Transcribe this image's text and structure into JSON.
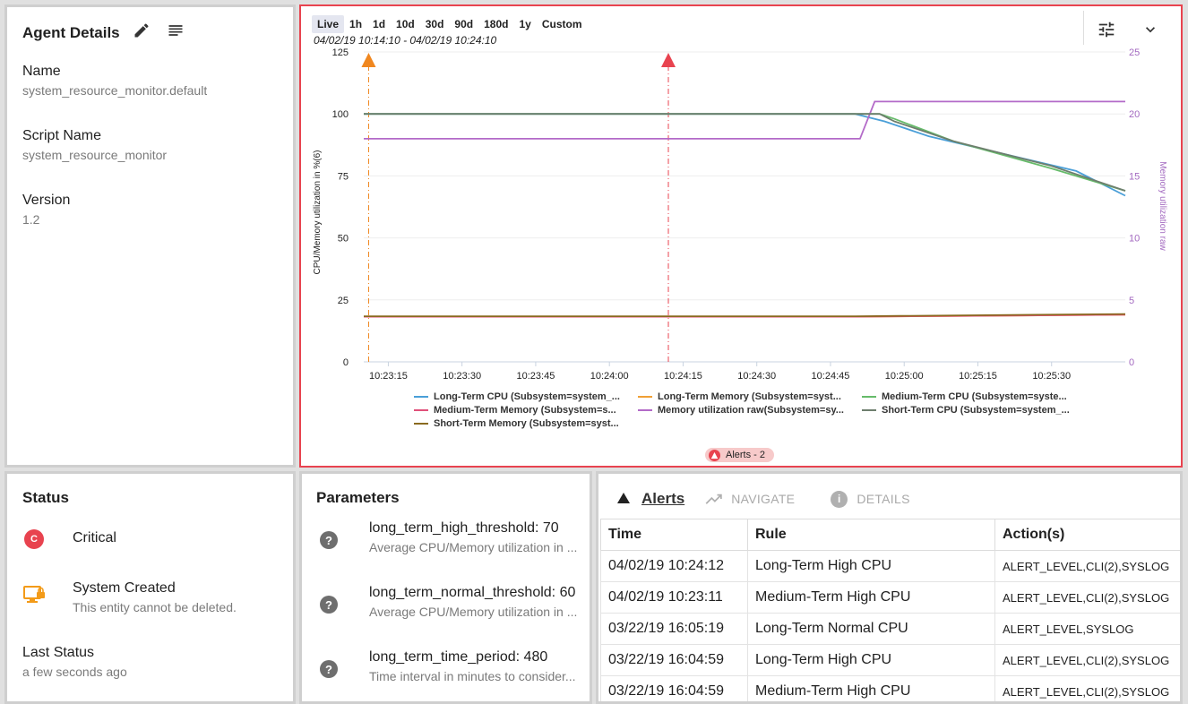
{
  "agent": {
    "title": "Agent Details",
    "fields": [
      {
        "label": "Name",
        "value": "system_resource_monitor.default"
      },
      {
        "label": "Script Name",
        "value": "system_resource_monitor"
      },
      {
        "label": "Version",
        "value": "1.2"
      }
    ]
  },
  "chart_panel": {
    "ranges": [
      "Live",
      "1h",
      "1d",
      "10d",
      "30d",
      "90d",
      "180d",
      "1y",
      "Custom"
    ],
    "active_range": "Live",
    "date_range": "04/02/19 10:14:10 - 04/02/19 10:24:10",
    "alerts_badge": "Alerts - 2"
  },
  "chart_data": {
    "type": "line",
    "ylabel": "CPU/Memory utilization in %(6)",
    "y2label": "Memory utilization raw",
    "ylim": [
      0,
      125
    ],
    "y2lim": [
      0,
      25
    ],
    "yticks": [
      0,
      25,
      50,
      75,
      100,
      125
    ],
    "y2ticks": [
      0,
      5,
      10,
      15,
      20,
      25
    ],
    "xticks": [
      "10:23:15",
      "10:23:30",
      "10:23:45",
      "10:24:00",
      "10:24:15",
      "10:24:30",
      "10:24:45",
      "10:25:00",
      "10:25:15",
      "10:25:30"
    ],
    "x_range_seconds": [
      0,
      155
    ],
    "markers": [
      {
        "x": "10:23:11",
        "color": "#f0871f"
      },
      {
        "x": "10:24:12",
        "color": "#e8434f"
      }
    ],
    "series": [
      {
        "name": "Long-Term CPU (Subsystem=system_...",
        "color": "#4a9fd8",
        "axis": "left",
        "points": [
          [
            0,
            100
          ],
          [
            100,
            100
          ],
          [
            106,
            97
          ],
          [
            115,
            91
          ],
          [
            130,
            84
          ],
          [
            145,
            77
          ],
          [
            155,
            67
          ]
        ]
      },
      {
        "name": "Long-Term Memory (Subsystem=syst...",
        "color": "#f0a035",
        "axis": "left",
        "points": [
          [
            0,
            18.2
          ],
          [
            100,
            18.2
          ],
          [
            155,
            19
          ]
        ]
      },
      {
        "name": "Medium-Term CPU (Subsystem=syste...",
        "color": "#66bb6a",
        "axis": "left",
        "points": [
          [
            0,
            100
          ],
          [
            100,
            100
          ],
          [
            105,
            100
          ],
          [
            108,
            98
          ],
          [
            120,
            89
          ],
          [
            140,
            78
          ],
          [
            155,
            69
          ]
        ]
      },
      {
        "name": "Medium-Term Memory (Subsystem=s...",
        "color": "#e0517a",
        "axis": "left",
        "points": [
          [
            0,
            18.2
          ],
          [
            100,
            18.2
          ],
          [
            155,
            19
          ]
        ]
      },
      {
        "name": "Memory utilization raw(Subsystem=sy...",
        "color": "#b36ac8",
        "axis": "right",
        "points": [
          [
            0,
            18
          ],
          [
            101,
            18
          ],
          [
            104,
            21
          ],
          [
            155,
            21
          ]
        ]
      },
      {
        "name": "Short-Term CPU (Subsystem=system_...",
        "color": "#6e7f6e",
        "axis": "left",
        "points": [
          [
            0,
            100
          ],
          [
            102,
            100
          ],
          [
            105,
            100
          ],
          [
            108,
            97
          ],
          [
            120,
            89
          ],
          [
            140,
            79
          ],
          [
            155,
            69
          ]
        ]
      },
      {
        "name": "Short-Term Memory (Subsystem=syst...",
        "color": "#8a6a1f",
        "axis": "left",
        "points": [
          [
            0,
            18.4
          ],
          [
            100,
            18.4
          ],
          [
            155,
            19.3
          ]
        ]
      }
    ]
  },
  "status": {
    "title": "Status",
    "state_label": "Critical",
    "state_badge": "C",
    "system_label": "System Created",
    "system_note": "This entity cannot be deleted.",
    "last_label": "Last Status",
    "last_value": "a few seconds ago"
  },
  "params": {
    "title": "Parameters",
    "items": [
      {
        "name": "long_term_high_threshold: 70",
        "desc": "Average CPU/Memory utilization in ..."
      },
      {
        "name": "long_term_normal_threshold: 60",
        "desc": "Average CPU/Memory utilization in ..."
      },
      {
        "name": "long_term_time_period: 480",
        "desc": "Time interval in minutes to consider..."
      }
    ]
  },
  "alerts": {
    "title": "Alerts",
    "navigate": "NAVIGATE",
    "details": "DETAILS",
    "columns": [
      "Time",
      "Rule",
      "Action(s)"
    ],
    "rows": [
      [
        "04/02/19 10:24:12",
        "Long-Term High CPU",
        "ALERT_LEVEL,CLI(2),SYSLOG"
      ],
      [
        "04/02/19 10:23:11",
        "Medium-Term High CPU",
        "ALERT_LEVEL,CLI(2),SYSLOG"
      ],
      [
        "03/22/19 16:05:19",
        "Long-Term Normal CPU",
        "ALERT_LEVEL,SYSLOG"
      ],
      [
        "03/22/19 16:04:59",
        "Long-Term High CPU",
        "ALERT_LEVEL,CLI(2),SYSLOG"
      ],
      [
        "03/22/19 16:04:59",
        "Medium-Term High CPU",
        "ALERT_LEVEL,CLI(2),SYSLOG"
      ]
    ]
  }
}
